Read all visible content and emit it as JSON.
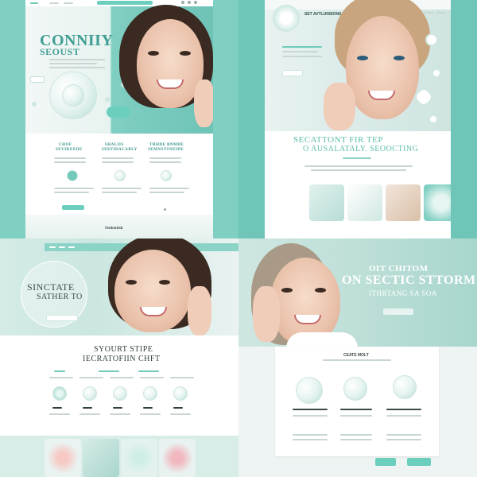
{
  "panel1": {
    "headline_1": "CONNIIY",
    "headline_2": "SEOUST",
    "cards": [
      {
        "title_1": "CHOF",
        "title_2": "SEVIKEEDE"
      },
      {
        "title_1": "SHALIIS",
        "title_2": "SEEFIDACABLY"
      },
      {
        "title_1": "TRHDE BNMDE",
        "title_2": "SEMNSTSNEIDE"
      }
    ],
    "footer": "Seubottish"
  },
  "panel2": {
    "header_title": "SET AVTLUNSIONS",
    "heading_1": "SECATTONT FIR TEP",
    "heading_2": "O AUSALATALY. SEOOCTING"
  },
  "panel3": {
    "hero_1": "SINCTATE",
    "hero_2": "SATHER TO",
    "heading_1": "SYOURT STIPE",
    "heading_2": "IECRATOFIIN CHFT"
  },
  "panel4": {
    "hero_1": "OIT CHITOM",
    "hero_2": "ON SECTIC STTORM",
    "hero_3": "ITHRTANG SA SOA",
    "card_title": "CEATE MOLT"
  },
  "colors": {
    "accent": "#6fcab9",
    "mint": "#7fcfc2",
    "text_teal": "#2f8f86"
  }
}
